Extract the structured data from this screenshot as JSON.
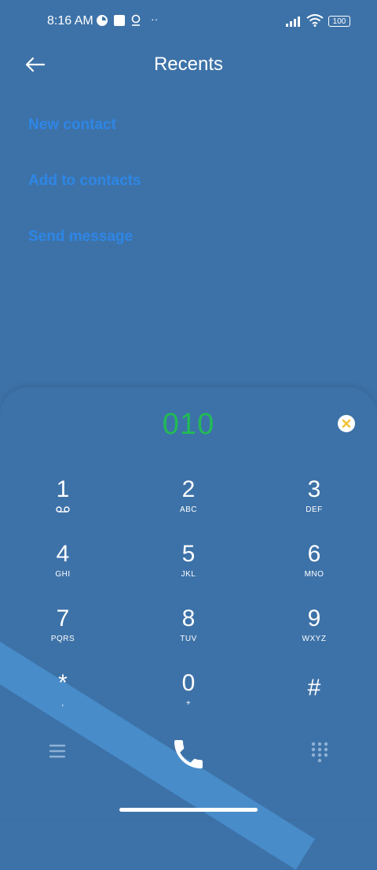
{
  "status_bar": {
    "time": "8:16 AM",
    "battery": "100"
  },
  "header": {
    "title": "Recents"
  },
  "actions": [
    {
      "label": "New contact"
    },
    {
      "label": "Add to contacts"
    },
    {
      "label": "Send message"
    }
  ],
  "dialer": {
    "number": "010",
    "keys": [
      {
        "num": "1",
        "sub": ""
      },
      {
        "num": "2",
        "sub": "ABC"
      },
      {
        "num": "3",
        "sub": "DEF"
      },
      {
        "num": "4",
        "sub": "GHI"
      },
      {
        "num": "5",
        "sub": "JKL"
      },
      {
        "num": "6",
        "sub": "MNO"
      },
      {
        "num": "7",
        "sub": "PQRS"
      },
      {
        "num": "8",
        "sub": "TUV"
      },
      {
        "num": "9",
        "sub": "WXYZ"
      },
      {
        "num": "*",
        "sub": ","
      },
      {
        "num": "0",
        "sub": "+"
      },
      {
        "num": "#",
        "sub": ""
      }
    ]
  },
  "colors": {
    "background": "#3d72a8",
    "digits": "#22bb55",
    "action_text": "#2e86e6",
    "clear_icon": "#f2c33a"
  },
  "icons": [
    "back-arrow-icon",
    "clear-digit-icon",
    "voicemail-icon",
    "menu-icon",
    "call-icon",
    "keypad-icon"
  ]
}
